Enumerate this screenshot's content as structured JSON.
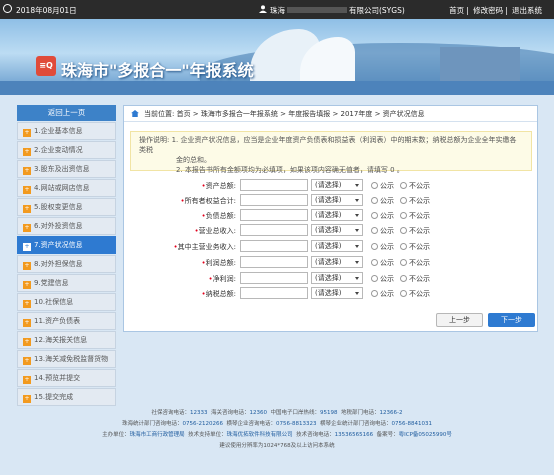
{
  "topbar": {
    "date": "2018年08月01日",
    "user": "珠海",
    "company_suffix": "有限公司(SYGS)",
    "links": [
      "首页",
      "修改密码",
      "退出系统"
    ]
  },
  "header": {
    "title": "珠海市\"多报合一\"年报系统"
  },
  "sidebar": {
    "back": "返回上一页",
    "items": [
      {
        "label": "1.企业基本信息"
      },
      {
        "label": "2.企业变动情况"
      },
      {
        "label": "3.股东及出资信息"
      },
      {
        "label": "4.网站或网店信息"
      },
      {
        "label": "5.股权变更信息"
      },
      {
        "label": "6.对外投资信息"
      },
      {
        "label": "7.资产状况信息"
      },
      {
        "label": "8.对外担保信息"
      },
      {
        "label": "9.党建信息"
      },
      {
        "label": "10.社保信息"
      },
      {
        "label": "11.资产负债表"
      },
      {
        "label": "12.海关报关信息"
      },
      {
        "label": "13.海关减免税监督货物"
      },
      {
        "label": "14.预览并提交"
      },
      {
        "label": "15.提交完成"
      }
    ]
  },
  "breadcrumb": "当前位置: 首页 > 珠海市多报合一年报系统 > 年度报告填报 > 2017年度 > 资产状况信息",
  "note": {
    "line1": "操作说明: 1. 企业资产状况信息，应当是企业年度资产负债表和损益表（利润表）中的期末数；纳税总额为企业全年实缴各类税",
    "line2": "金的总和。",
    "line3": "2. 本报告书所有金额项均为必填项，如果该项内容确无值者，请填写 0 。"
  },
  "form": {
    "select_placeholder": "(请选择)",
    "public": "公示",
    "not_public": "不公示",
    "fields": [
      {
        "label": "资产总额:"
      },
      {
        "label": "所有者权益合计:"
      },
      {
        "label": "负债总额:"
      },
      {
        "label": "营业总收入:"
      },
      {
        "label": "其中主营业务收入:"
      },
      {
        "label": "利润总额:"
      },
      {
        "label": "净利润:"
      },
      {
        "label": "纳税总额:"
      }
    ]
  },
  "buttons": {
    "prev": "上一步",
    "next": "下一步"
  },
  "footer": {
    "l1a": "社保咨询电话：",
    "l1b": "12333",
    "l1c": "海关咨询电话：",
    "l1d": "12360",
    "l1e": "中国电子口岸热线：",
    "l1f": "95198",
    "l1g": "地税部门电话：",
    "l1h": "12366-2",
    "l2a": "珠海统计部门咨询电话：",
    "l2b": "0756-2120266",
    "l2c": "横琴企业咨询电话：",
    "l2d": "0756-8813323",
    "l2e": "横琴企业统计部门咨询电话：",
    "l2f": "0756-8841031",
    "l3a": "主办单位：",
    "l3b": "珠海市工商行政管理局",
    "l3c": "技术支持单位：",
    "l3d": "珠海优拓软件科技有限公司",
    "l3e": "技术咨询电话：",
    "l3f": "13536565166",
    "l3g": "备案号：",
    "l3h": "粤ICP备05025990号",
    "l4": "建议使用分辨率为1024*768及以上访问本系统"
  }
}
